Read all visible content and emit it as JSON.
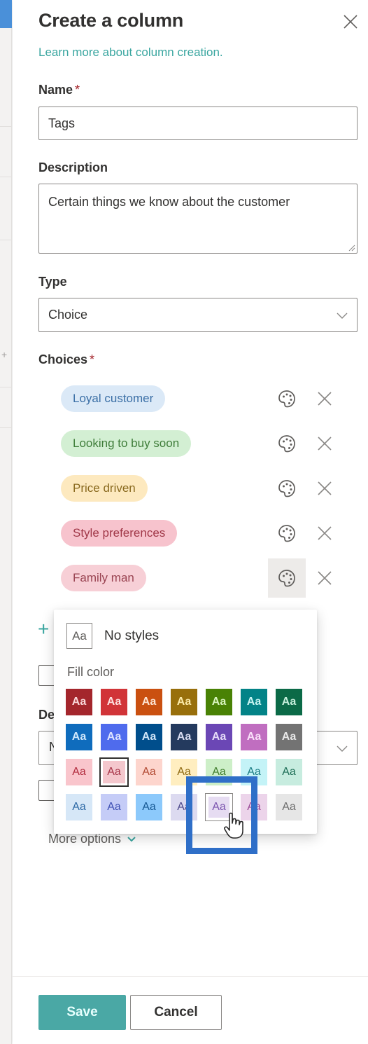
{
  "panel": {
    "title": "Create a column",
    "learn_more_link": "Learn more about column creation."
  },
  "fields": {
    "name": {
      "label": "Name",
      "required_mark": "*",
      "value": "Tags"
    },
    "description": {
      "label": "Description",
      "value": "Certain things we know about the customer"
    },
    "type": {
      "label": "Type",
      "value": "Choice"
    },
    "choices": {
      "label": "Choices",
      "required_mark": "*",
      "items": [
        {
          "label": "Loyal customer",
          "bg": "#dbe9f7",
          "fg": "#3b6fa6"
        },
        {
          "label": "Looking to buy soon",
          "bg": "#d3efd3",
          "fg": "#3f7d3a"
        },
        {
          "label": "Price driven",
          "bg": "#fde9bf",
          "fg": "#8a6a1f"
        },
        {
          "label": "Style preferences",
          "bg": "#f7c3cd",
          "fg": "#a03848"
        },
        {
          "label": "Family man",
          "bg": "#f7cfd6",
          "fg": "#9a4452"
        }
      ]
    },
    "default_value": {
      "label_partial": "De",
      "value_partial": "N"
    }
  },
  "style_popup": {
    "no_styles_swatch": "Aa",
    "no_styles_label": "No styles",
    "fill_color_label": "Fill color",
    "swatch_text": "Aa",
    "swatches": [
      {
        "bg": "#a4262c",
        "fg": "#f9d8da",
        "shade": "dark"
      },
      {
        "bg": "#d13438",
        "fg": "#fde0e0",
        "shade": "dark"
      },
      {
        "bg": "#ca5010",
        "fg": "#fde4d3",
        "shade": "dark"
      },
      {
        "bg": "#986f0b",
        "fg": "#fbeaa8",
        "shade": "dark"
      },
      {
        "bg": "#498205",
        "fg": "#d9f5c0",
        "shade": "dark"
      },
      {
        "bg": "#038387",
        "fg": "#c8f4f2",
        "shade": "dark"
      },
      {
        "bg": "#0b6a47",
        "fg": "#c6efdc",
        "shade": "dark"
      },
      {
        "bg": "#0f6cbd",
        "fg": "#cfe7fb",
        "shade": "dark"
      },
      {
        "bg": "#4f6bed",
        "fg": "#dde3ff",
        "shade": "dark"
      },
      {
        "bg": "#004e8c",
        "fg": "#cfe4f7",
        "shade": "dark"
      },
      {
        "bg": "#243a5e",
        "fg": "#d8dcf0",
        "shade": "dark"
      },
      {
        "bg": "#6b47b5",
        "fg": "#e6dcf8",
        "shade": "dark"
      },
      {
        "bg": "#c06ec0",
        "fg": "#f9e0f9",
        "shade": "dark"
      },
      {
        "bg": "#737373",
        "fg": "#e8e8e8",
        "shade": "dark"
      },
      {
        "bg": "#f9c5cc",
        "fg": "#b22c3e",
        "shade": "light"
      },
      {
        "bg": "#f4c7cd",
        "fg": "#a8364a",
        "shade": "light",
        "selected": true
      },
      {
        "bg": "#fdd5cd",
        "fg": "#b24a33",
        "shade": "light"
      },
      {
        "bg": "#ffeec0",
        "fg": "#8f6a12",
        "shade": "light"
      },
      {
        "bg": "#cdefc8",
        "fg": "#3f7d2c",
        "shade": "light"
      },
      {
        "bg": "#c4f3f7",
        "fg": "#1b7c84",
        "shade": "light"
      },
      {
        "bg": "#c7ecdf",
        "fg": "#1e6e57",
        "shade": "light"
      },
      {
        "bg": "#d6e7f7",
        "fg": "#2f6aa6",
        "shade": "light"
      },
      {
        "bg": "#c5ccf7",
        "fg": "#4052b5",
        "shade": "light"
      },
      {
        "bg": "#8cc9fb",
        "fg": "#185a95",
        "shade": "light"
      },
      {
        "bg": "#dcdaf0",
        "fg": "#4e4a8c",
        "shade": "light"
      },
      {
        "bg": "#e6dcf2",
        "fg": "#7d56b0",
        "shade": "light",
        "hovered": true
      },
      {
        "bg": "#ecd4ea",
        "fg": "#9a4a96",
        "shade": "light"
      },
      {
        "bg": "#e6e6e6",
        "fg": "#6e6e6e",
        "shade": "light"
      }
    ]
  },
  "more_options_label": "More options",
  "footer": {
    "save_label": "Save",
    "cancel_label": "Cancel"
  },
  "colors": {
    "accent": "#4aa8a5",
    "link": "#3aa6a0",
    "annotation": "#2f6fc8"
  }
}
